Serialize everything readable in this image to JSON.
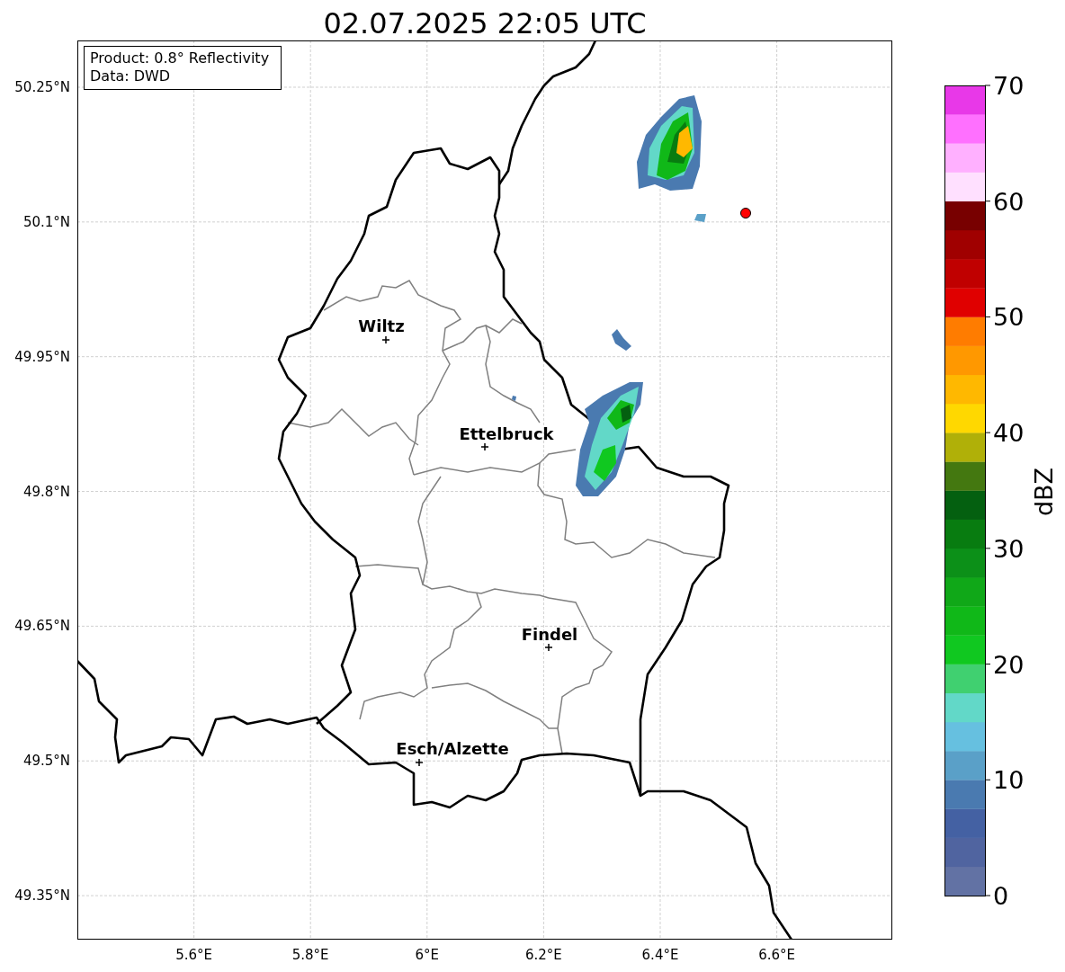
{
  "title": "02.07.2025 22:05 UTC",
  "info_box": [
    "Product: 0.8° Reflectivity",
    "Data: DWD"
  ],
  "map": {
    "y_ticks": [
      "50.25°N",
      "50.1°N",
      "49.95°N",
      "49.8°N",
      "49.65°N",
      "49.5°N",
      "49.35°N"
    ],
    "x_ticks": [
      "5.6°E",
      "5.8°E",
      "6°E",
      "6.2°E",
      "6.4°E",
      "6.6°E"
    ],
    "cities": [
      {
        "name": "Wiltz"
      },
      {
        "name": "Ettelbruck"
      },
      {
        "name": "Findel"
      },
      {
        "name": "Esch/Alzette"
      }
    ]
  },
  "colorbar": {
    "label": "dBZ",
    "ticks": [
      "70",
      "60",
      "50",
      "40",
      "30",
      "20",
      "10",
      "0"
    ],
    "segments": [
      {
        "color": "#6272a4"
      },
      {
        "color": "#5064a0"
      },
      {
        "color": "#4461a3"
      },
      {
        "color": "#4a7ab0"
      },
      {
        "color": "#5aa0c8"
      },
      {
        "color": "#66c0e0"
      },
      {
        "color": "#62d8c8"
      },
      {
        "color": "#40d070"
      },
      {
        "color": "#10c820"
      },
      {
        "color": "#10b818"
      },
      {
        "color": "#10a818"
      },
      {
        "color": "#0c9018"
      },
      {
        "color": "#087c10"
      },
      {
        "color": "#046010"
      },
      {
        "color": "#447810"
      },
      {
        "color": "#b0b008"
      },
      {
        "color": "#ffd800"
      },
      {
        "color": "#ffb800"
      },
      {
        "color": "#ff9800"
      },
      {
        "color": "#ff7c00"
      },
      {
        "color": "#e00000"
      },
      {
        "color": "#c00000"
      },
      {
        "color": "#a00000"
      },
      {
        "color": "#780000"
      },
      {
        "color": "#ffe0ff"
      },
      {
        "color": "#ffb0ff"
      },
      {
        "color": "#ff70ff"
      },
      {
        "color": "#e838e8"
      }
    ]
  }
}
